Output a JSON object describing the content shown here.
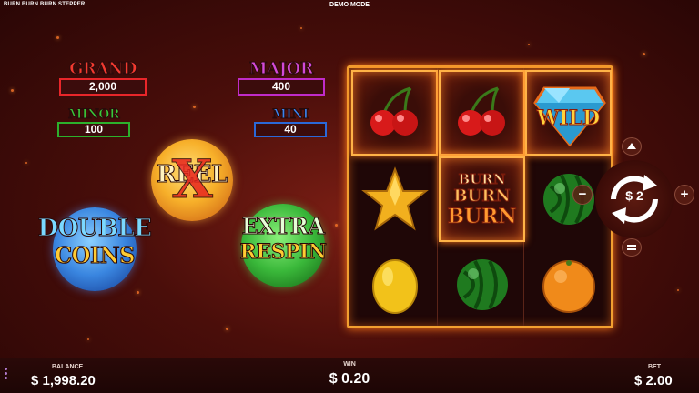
{
  "header": {
    "game_name": "BURN BURN BURN STEPPER",
    "mode": "DEMO MODE"
  },
  "jackpots": {
    "grand": {
      "label": "GRAND",
      "value": "2,000",
      "color": "#e8262a"
    },
    "major": {
      "label": "MAJOR",
      "value": "400",
      "color": "#c02cc8"
    },
    "minor": {
      "label": "MINOR",
      "value": "100",
      "color": "#2cb02c"
    },
    "mini": {
      "label": "MINI",
      "value": "40",
      "color": "#2a68d8"
    }
  },
  "features": {
    "reel_x": {
      "line1": "REEL",
      "line2": "X"
    },
    "double_coins": {
      "line1": "DOUBLE",
      "line2": "COINS"
    },
    "extra_respin": {
      "line1": "EXTRA",
      "line2": "RESPIN"
    }
  },
  "reels": {
    "cells": [
      {
        "symbol": "cherry",
        "burning": true
      },
      {
        "symbol": "cherry",
        "burning": true
      },
      {
        "symbol": "wild",
        "label": "WILD",
        "burning": true
      },
      {
        "symbol": "star",
        "burning": false
      },
      {
        "symbol": "burn",
        "label_lines": [
          "BURN",
          "BURN",
          "BURN"
        ],
        "burning": true
      },
      {
        "symbol": "watermelon",
        "burning": false
      },
      {
        "symbol": "lemon",
        "burning": false
      },
      {
        "symbol": "watermelon",
        "burning": false
      },
      {
        "symbol": "orange",
        "burning": false
      }
    ]
  },
  "controls": {
    "bet_display": "$ 2",
    "minus": "−",
    "plus": "+"
  },
  "footer": {
    "balance_label": "BALANCE",
    "balance_value": "$ 1,998.20",
    "win_label": "WIN",
    "win_value": "$ 0.20",
    "bet_label": "BET",
    "bet_value": "$ 2.00"
  }
}
